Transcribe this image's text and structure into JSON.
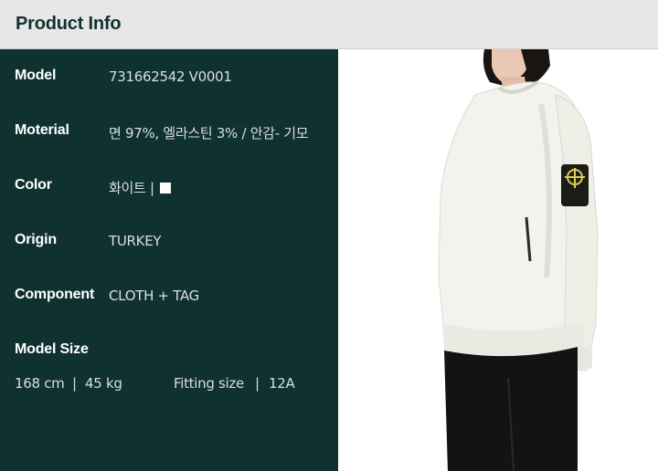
{
  "header": {
    "title": "Product Info"
  },
  "info": [
    {
      "label": "Model",
      "value": "731662542 V0001"
    },
    {
      "label": "Moterial",
      "value": "면 97%, 엘라스틴 3% / 안감- 기모"
    },
    {
      "label": "Color",
      "value": "화이트 | ",
      "swatch_color": "#ffffff"
    },
    {
      "label": "Origin",
      "value": "TURKEY"
    },
    {
      "label": "Component",
      "value": "CLOTH + TAG"
    }
  ],
  "model_size": {
    "label": "Model Size",
    "height": "168 cm",
    "sep1": "|",
    "weight": "45 kg",
    "fitting_label": "Fitting size",
    "sep2": "|",
    "fitting_value": "12A"
  },
  "colors": {
    "header_bg": "#e7e7e7",
    "header_text": "#12302e",
    "panel_bg": "#0f3130",
    "label_text": "#ffffff",
    "value_text": "#d9dfde"
  },
  "photo": {
    "icon": "model-wearing-white-sweatshirt"
  }
}
